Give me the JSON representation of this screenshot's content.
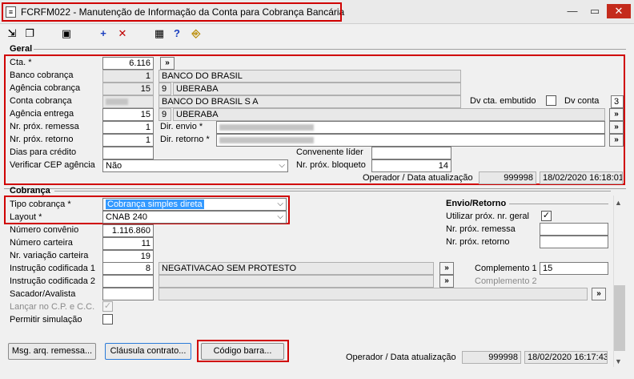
{
  "window": {
    "title": "FCRFM022 - Manutenção de Informação da Conta para Cobrança Bancária"
  },
  "geral": {
    "title": "Geral",
    "cta_label": "Cta. *",
    "cta_value": "6.116",
    "banco_label": "Banco cobrança",
    "banco_code": "1",
    "banco_name": "BANCO DO BRASIL",
    "agencia_cob_label": "Agência cobrança",
    "agencia_cob_code": "15",
    "agencia_cob_dv": "9",
    "agencia_cob_name": "UBERABA",
    "conta_cob_label": "Conta cobrança",
    "conta_cob_name": "BANCO DO BRASIL S A",
    "dv_embutido_label": "Dv cta. embutido",
    "dv_conta_label": "Dv conta",
    "dv_conta_value": "3",
    "agencia_ent_label": "Agência entrega",
    "agencia_ent_code": "15",
    "agencia_ent_dv": "9",
    "agencia_ent_name": "UBERABA",
    "remessa_label": "Nr. próx. remessa",
    "remessa_value": "1",
    "retorno_label": "Nr. próx. retorno",
    "retorno_value": "1",
    "dir_envio_label": "Dir. envio *",
    "dir_retorno_label": "Dir. retorno *",
    "dias_credito_label": "Dias para crédito",
    "convenente_label": "Convenente líder",
    "cep_label": "Verificar CEP agência",
    "cep_value": "Não",
    "bloqueto_label": "Nr. próx. bloqueto",
    "bloqueto_value": "14",
    "operador_label": "Operador / Data atualização",
    "operador_value": "999998",
    "data_value": "18/02/2020 16:18:01"
  },
  "cobranca": {
    "title": "Cobrança",
    "tipo_label": "Tipo cobrança *",
    "tipo_value": "Cobrança simples direta",
    "layout_label": "Layout *",
    "layout_value": "CNAB 240",
    "convenio_label": "Número convênio",
    "convenio_value": "1.116.860",
    "carteira_label": "Número carteira",
    "carteira_value": "11",
    "variacao_label": "Nr. variação carteira",
    "variacao_value": "19",
    "instr1_label": "Instrução codificada 1",
    "instr1_code": "8",
    "instr1_text": "NEGATIVACAO SEM PROTESTO",
    "instr2_label": "Instrução codificada 2",
    "complemento1_label": "Complemento 1",
    "complemento1_value": "15",
    "complemento2_label": "Complemento 2",
    "sacador_label": "Sacador/Avalista",
    "lancar_label": "Lançar no C.P. e C.C.",
    "simulacao_label": "Permitir simulação",
    "envio_retorno_title": "Envio/Retorno",
    "utilizar_label": "Utilizar próx. nr. geral",
    "prox_remessa_label": "Nr. próx. remessa",
    "prox_retorno_label": "Nr. próx. retorno",
    "operador_label": "Operador / Data atualização",
    "operador_value": "999998",
    "data_value": "18/02/2020 16:17:43"
  },
  "buttons": {
    "msg_arq": "Msg. arq. remessa...",
    "clausula": "Cláusula contrato...",
    "codigo_barra": "Código barra..."
  }
}
